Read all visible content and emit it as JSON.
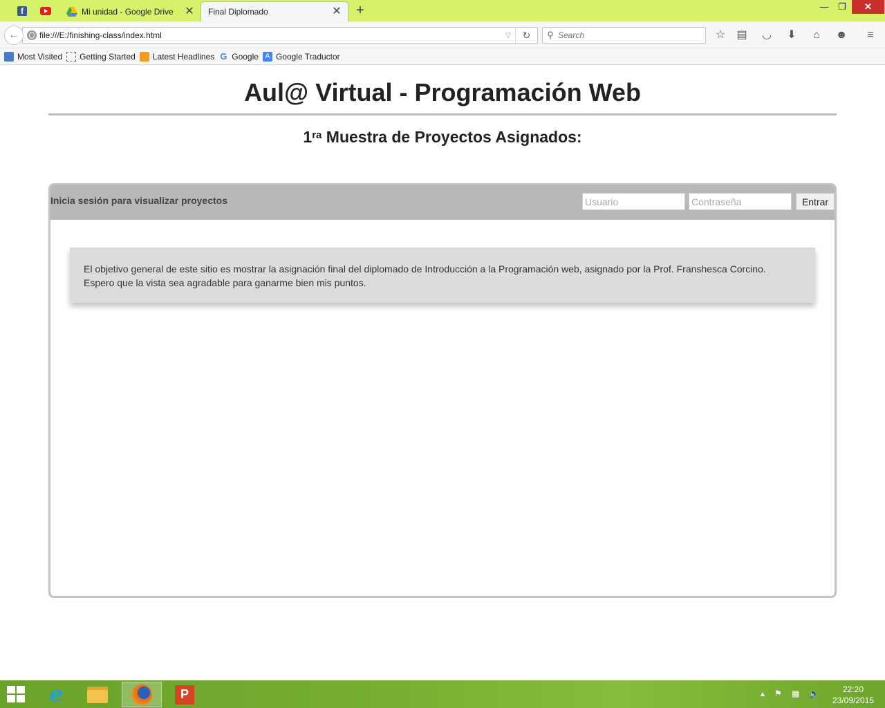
{
  "browser": {
    "tabs": [
      {
        "label": "Mi unidad - Google Drive",
        "active": false
      },
      {
        "label": "Final Diplomado",
        "active": true
      }
    ],
    "url": "file:///E:/finishing-class/index.html",
    "search_placeholder": "Search",
    "bookmarks": [
      {
        "label": "Most Visited",
        "icon": "most-visited-icon"
      },
      {
        "label": "Getting Started",
        "icon": "page-icon"
      },
      {
        "label": "Latest Headlines",
        "icon": "rss-icon"
      },
      {
        "label": "Google",
        "icon": "google-icon"
      },
      {
        "label": "Google Traductor",
        "icon": "translate-icon"
      }
    ]
  },
  "page": {
    "title": "Aul@ Virtual - Programación Web",
    "subtitle_num": "1",
    "subtitle_sup": "ra",
    "subtitle_text": " Muestra de Proyectos Asignados:",
    "login": {
      "label": "Inicia sesión para visualizar proyectos",
      "user_placeholder": "Usuario",
      "pass_placeholder": "Contraseña",
      "button": "Entrar"
    },
    "info_line1": "El objetivo general de este sitio es mostrar la asignación final del diplomado de Introducción a la Programación web, asignado por la Prof. Franshesca Corcino.",
    "info_line2": "Espero que la vista sea agradable para ganarme bien mis puntos."
  },
  "taskbar": {
    "time": "22:20",
    "date": "23/09/2015"
  },
  "colors": {
    "tabbar": "#d6f26a",
    "panel_header": "#b8b8b8",
    "info_box": "#dcdcdc",
    "taskbar": "#74ad2f"
  }
}
